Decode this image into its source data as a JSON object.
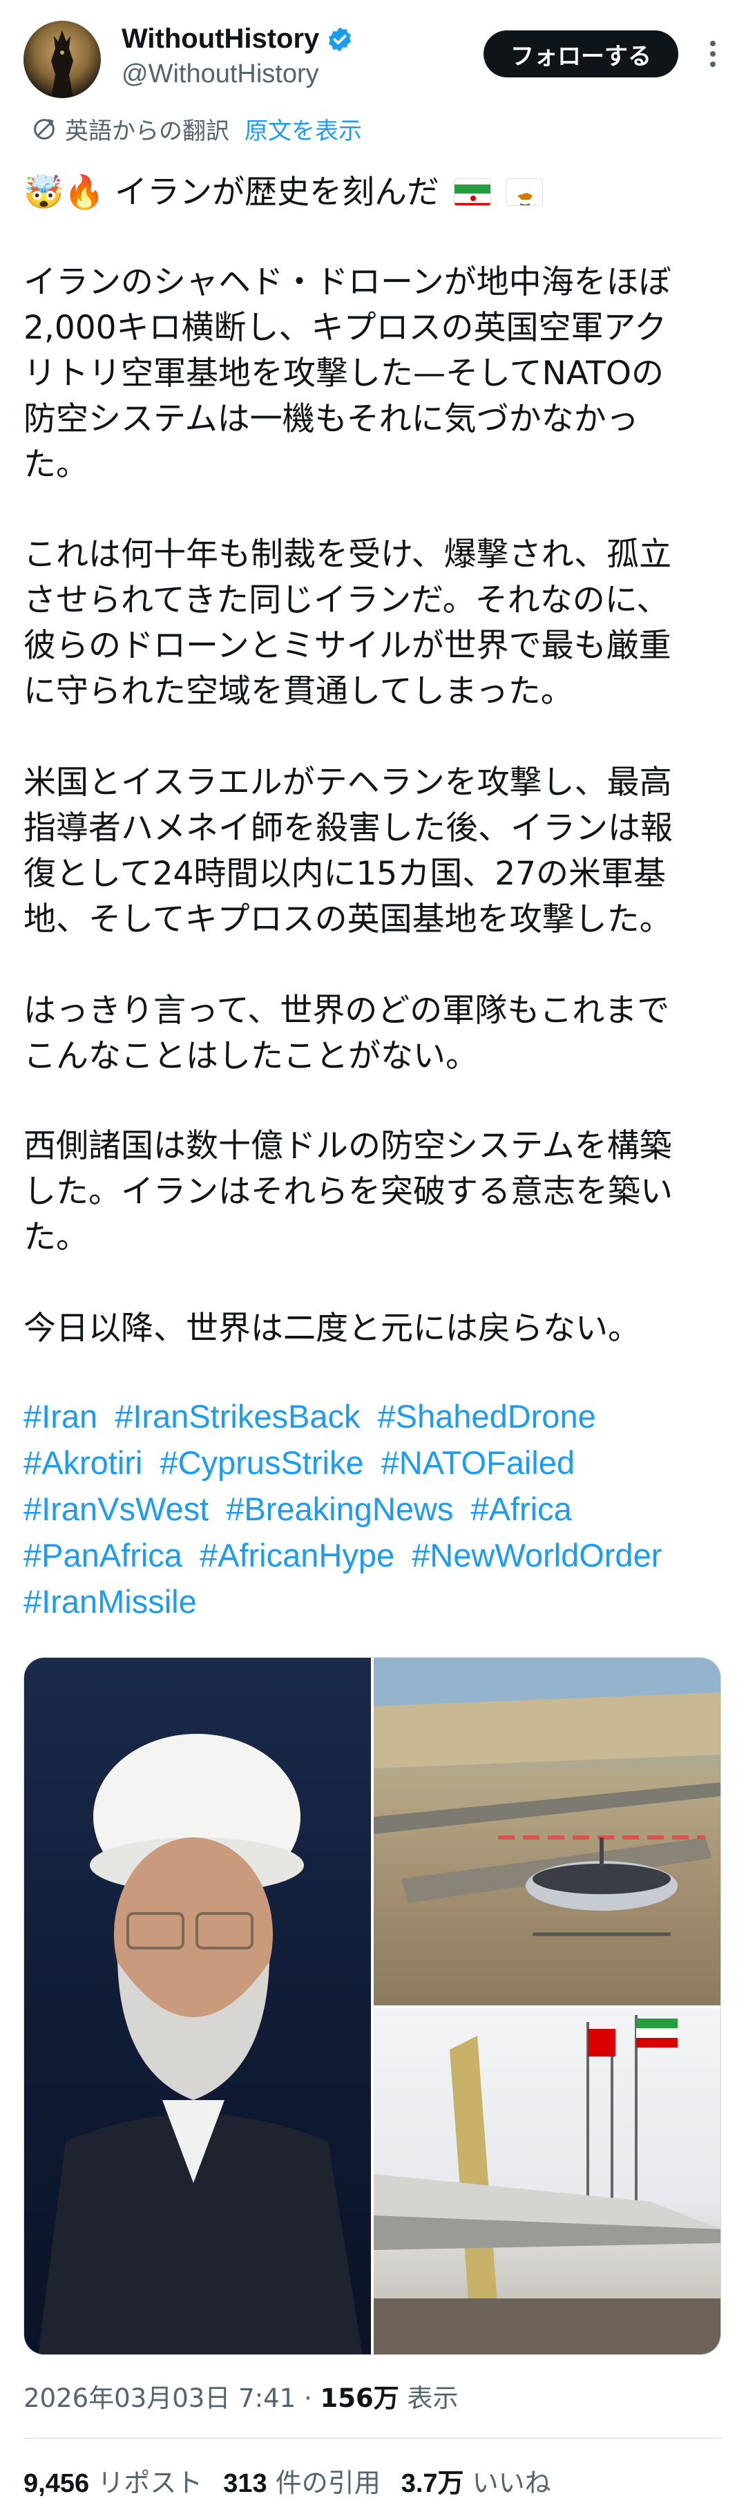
{
  "user": {
    "display_name": "WithoutHistory",
    "handle": "@WithoutHistory",
    "follow_label": "フォローする"
  },
  "translation": {
    "label": "英語からの翻訳",
    "show_original": "原文を表示"
  },
  "post": {
    "headline": "🤯🔥 イランが歴史を刻んだ",
    "p1": [
      "イランのシャヘド・ドローンが地中海をほぼ",
      "2,000キロ横断し、キプロスの英国空軍アク",
      "リトリ空軍基地を攻撃した—そしてNATOの",
      "防空システムは一機もそれに気づかなかっ",
      "た。"
    ],
    "p2": [
      "これは何十年も制裁を受け、爆撃され、孤立",
      "させられてきた同じイランだ。それなのに、",
      "彼らのドローンとミサイルが世界で最も厳重",
      "に守られた空域を貫通してしまった。"
    ],
    "p3": [
      "米国とイスラエルがテヘランを攻撃し、最高",
      "指導者ハメネイ師を殺害した後、イランは報",
      "復として24時間以内に15カ国、27の米軍基",
      "地、そしてキプロスの英国基地を攻撃した。"
    ],
    "p4": [
      "はっきり言って、世界のどの軍隊もこれまで",
      "こんなことはしたことがない。"
    ],
    "p5": [
      "西側諸国は数十億ドルの防空システムを構築",
      "した。イランはそれらを突破する意志を築い",
      "た。"
    ],
    "p6": [
      "今日以降、世界は二度と元には戻らない。"
    ]
  },
  "hashtags": [
    [
      "#Iran",
      "#IranStrikesBack",
      "#ShahedDrone"
    ],
    [
      "#Akrotiri",
      "#CyprusStrike",
      "#NATOFailed"
    ],
    [
      "#IranVsWest",
      "#BreakingNews",
      "#Africa"
    ],
    [
      "#PanAfrica",
      "#AfricanHype",
      "#NewWorldOrder"
    ],
    [
      "#IranMissile"
    ]
  ],
  "meta": {
    "date": "2026年03月03日 7:41",
    "separator": "·",
    "views_count": "156万",
    "views_label": "表示"
  },
  "stats": {
    "reposts_count": "9,456",
    "reposts_label": "リポスト",
    "quotes_count": "313",
    "quotes_label": "件の引用",
    "likes_count": "3.7万",
    "likes_label": "いいね"
  },
  "colors": {
    "link": "#1d9bf0",
    "text": "#0f1419",
    "secondary": "#536471",
    "follow_bg": "#0f1419"
  }
}
